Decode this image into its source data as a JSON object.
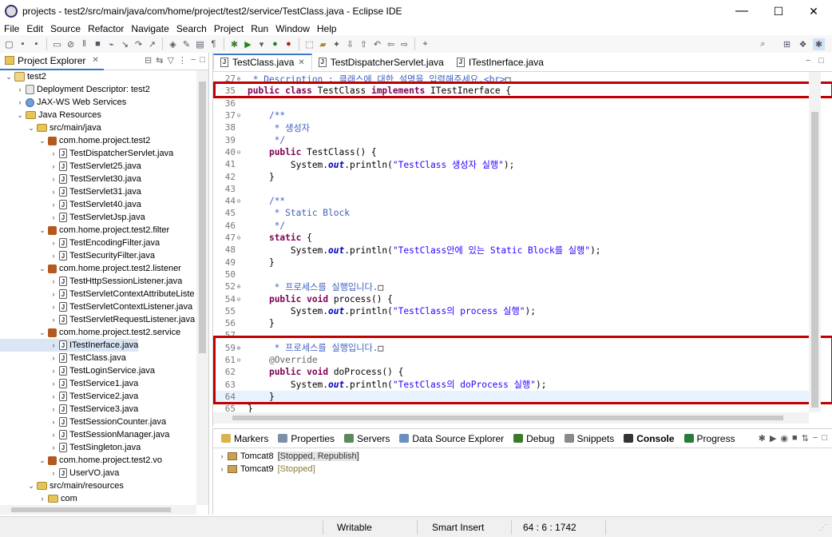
{
  "window": {
    "title": "projects - test2/src/main/java/com/home/project/test2/service/TestClass.java - Eclipse IDE",
    "minimize": "—",
    "maximize": "☐",
    "close": "✕"
  },
  "menu": [
    "File",
    "Edit",
    "Source",
    "Refactor",
    "Navigate",
    "Search",
    "Project",
    "Run",
    "Window",
    "Help"
  ],
  "explorer": {
    "tab_label": "Project Explorer",
    "items": [
      {
        "label": "test2",
        "icon": "project-icon",
        "expanded": true,
        "level": 0
      },
      {
        "label": "Deployment Descriptor: test2",
        "icon": "descriptor-icon",
        "expanded": false,
        "level": 1
      },
      {
        "label": "JAX-WS Web Services",
        "icon": "web-services-icon",
        "expanded": false,
        "level": 1
      },
      {
        "label": "Java Resources",
        "icon": "java-resources-icon",
        "expanded": true,
        "level": 1
      },
      {
        "label": "src/main/java",
        "icon": "source-folder-icon",
        "expanded": true,
        "level": 2
      },
      {
        "label": "com.home.project.test2",
        "icon": "package-icon",
        "expanded": true,
        "level": 3
      },
      {
        "label": "TestDispatcherServlet.java",
        "icon": "java-file-icon",
        "expanded": false,
        "level": 4
      },
      {
        "label": "TestServlet25.java",
        "icon": "java-file-icon",
        "expanded": false,
        "level": 4
      },
      {
        "label": "TestServlet30.java",
        "icon": "java-file-icon",
        "expanded": false,
        "level": 4
      },
      {
        "label": "TestServlet31.java",
        "icon": "java-file-icon",
        "expanded": false,
        "level": 4
      },
      {
        "label": "TestServlet40.java",
        "icon": "java-file-icon",
        "expanded": false,
        "level": 4
      },
      {
        "label": "TestServletJsp.java",
        "icon": "java-file-icon",
        "expanded": false,
        "level": 4
      },
      {
        "label": "com.home.project.test2.filter",
        "icon": "package-icon",
        "expanded": true,
        "level": 3
      },
      {
        "label": "TestEncodingFilter.java",
        "icon": "java-file-icon",
        "expanded": false,
        "level": 4
      },
      {
        "label": "TestSecurityFilter.java",
        "icon": "java-file-icon",
        "expanded": false,
        "level": 4
      },
      {
        "label": "com.home.project.test2.listener",
        "icon": "package-icon",
        "expanded": true,
        "level": 3
      },
      {
        "label": "TestHttpSessionListener.java",
        "icon": "java-file-icon",
        "expanded": false,
        "level": 4
      },
      {
        "label": "TestServletContextAttributeListe",
        "icon": "java-file-icon",
        "expanded": false,
        "level": 4
      },
      {
        "label": "TestServletContextListener.java",
        "icon": "java-file-icon",
        "expanded": false,
        "level": 4
      },
      {
        "label": "TestServletRequestListener.java",
        "icon": "java-file-icon",
        "expanded": false,
        "level": 4
      },
      {
        "label": "com.home.project.test2.service",
        "icon": "package-icon",
        "expanded": true,
        "level": 3
      },
      {
        "label": "ITestInerface.java",
        "icon": "java-file-icon",
        "expanded": false,
        "level": 4,
        "selected": true
      },
      {
        "label": "TestClass.java",
        "icon": "java-file-icon",
        "expanded": false,
        "level": 4
      },
      {
        "label": "TestLoginService.java",
        "icon": "java-file-icon",
        "expanded": false,
        "level": 4
      },
      {
        "label": "TestService1.java",
        "icon": "java-file-icon",
        "expanded": false,
        "level": 4
      },
      {
        "label": "TestService2.java",
        "icon": "java-file-icon",
        "expanded": false,
        "level": 4
      },
      {
        "label": "TestService3.java",
        "icon": "java-file-icon",
        "expanded": false,
        "level": 4
      },
      {
        "label": "TestSessionCounter.java",
        "icon": "java-file-icon",
        "expanded": false,
        "level": 4
      },
      {
        "label": "TestSessionManager.java",
        "icon": "java-file-icon",
        "expanded": false,
        "level": 4
      },
      {
        "label": "TestSingleton.java",
        "icon": "java-file-icon",
        "expanded": false,
        "level": 4
      },
      {
        "label": "com.home.project.test2.vo",
        "icon": "package-icon",
        "expanded": true,
        "level": 3
      },
      {
        "label": "UserVO.java",
        "icon": "java-file-icon",
        "expanded": false,
        "level": 4
      },
      {
        "label": "src/main/resources",
        "icon": "source-folder-icon",
        "expanded": true,
        "level": 2
      },
      {
        "label": "com",
        "icon": "folder-icon",
        "expanded": false,
        "level": 3
      }
    ]
  },
  "editor": {
    "tabs": [
      {
        "label": "TestClass.java",
        "active": true
      },
      {
        "label": "TestDispatcherServlet.java",
        "active": false
      },
      {
        "label": "ITestInerface.java",
        "active": false
      }
    ],
    "lines": [
      {
        "n": "27",
        "fold": "⊕",
        "html": "<span class='cm'> * Description : 클래스에 대한 설명을 입력해주세요.&lt;br&gt;</span>□"
      },
      {
        "n": "35",
        "fold": "",
        "html": "<span class='kw'>public</span> <span class='kw'>class</span> TestClass <span class='kw'>implements</span> ITestInerface {"
      },
      {
        "n": "36",
        "fold": "",
        "html": ""
      },
      {
        "n": "37",
        "fold": "⊖",
        "html": "    <span class='cm'>/**</span>"
      },
      {
        "n": "38",
        "fold": "",
        "html": "<span class='cm'>     * 생성자</span>"
      },
      {
        "n": "39",
        "fold": "",
        "html": "<span class='cm'>     */</span>"
      },
      {
        "n": "40",
        "fold": "⊖",
        "html": "    <span class='kw'>public</span> TestClass() {"
      },
      {
        "n": "41",
        "fold": "",
        "html": "        System.<span class='sf'>out</span>.println(<span class='st'>\"TestClass 생성자 실행\"</span>);"
      },
      {
        "n": "42",
        "fold": "",
        "html": "    }"
      },
      {
        "n": "43",
        "fold": "",
        "html": ""
      },
      {
        "n": "44",
        "fold": "⊖",
        "html": "    <span class='cm'>/**</span>"
      },
      {
        "n": "45",
        "fold": "",
        "html": "<span class='cm'>     * Static Block</span>"
      },
      {
        "n": "46",
        "fold": "",
        "html": "<span class='cm'>     */</span>"
      },
      {
        "n": "47",
        "fold": "⊖",
        "html": "    <span class='kw'>static</span> {"
      },
      {
        "n": "48",
        "fold": "",
        "html": "        System.<span class='sf'>out</span>.println(<span class='st'>\"TestClass안에 있는 Static Block를 실행\"</span>);"
      },
      {
        "n": "49",
        "fold": "",
        "html": "    }"
      },
      {
        "n": "50",
        "fold": "",
        "html": ""
      },
      {
        "n": "52",
        "fold": "⊕",
        "html": "<span class='cm'>     * 프로세스를 실행입니다.</span>□"
      },
      {
        "n": "54",
        "fold": "⊖",
        "html": "    <span class='kw'>public</span> <span class='kw'>void</span> process() {"
      },
      {
        "n": "55",
        "fold": "",
        "html": "        System.<span class='sf'>out</span>.println(<span class='st'>\"TestClass의 process 실행\"</span>);"
      },
      {
        "n": "56",
        "fold": "",
        "html": "    }"
      },
      {
        "n": "57",
        "fold": "",
        "html": ""
      },
      {
        "n": "59",
        "fold": "⊕",
        "html": "<span class='cm'>     * 프로세스를 실행입니다.</span>□"
      },
      {
        "n": "61",
        "fold": "⊖",
        "html": "    <span class='an'>@Override</span>"
      },
      {
        "n": "62",
        "fold": "",
        "html": "    <span class='kw'>public</span> <span class='kw'>void</span> doProcess() {"
      },
      {
        "n": "63",
        "fold": "",
        "html": "        System.<span class='sf'>out</span>.println(<span class='st'>\"TestClass의 doProcess 실행\"</span>);"
      },
      {
        "n": "64",
        "fold": "",
        "html": "    }",
        "current": true
      },
      {
        "n": "65",
        "fold": "",
        "html": "}"
      }
    ]
  },
  "bottom_panel": {
    "tabs": [
      {
        "label": "Markers",
        "icon": "markers-icon",
        "active": false
      },
      {
        "label": "Properties",
        "icon": "properties-icon",
        "active": false
      },
      {
        "label": "Servers",
        "icon": "servers-icon",
        "active": false
      },
      {
        "label": "Data Source Explorer",
        "icon": "data-source-icon",
        "active": false
      },
      {
        "label": "Debug",
        "icon": "debug-icon",
        "active": false
      },
      {
        "label": "Snippets",
        "icon": "snippets-icon",
        "active": false
      },
      {
        "label": "Console",
        "icon": "console-icon",
        "active": true
      },
      {
        "label": "Progress",
        "icon": "progress-icon",
        "active": false
      }
    ],
    "servers": [
      {
        "name": "Tomcat8",
        "status": "[Stopped, Republish]"
      },
      {
        "name": "Tomcat9",
        "status": "[Stopped]"
      }
    ]
  },
  "statusbar": {
    "mode": "Writable",
    "insert": "Smart Insert",
    "position": "64 : 6 : 1742"
  },
  "colors": {
    "highlight_box": "#c00000",
    "keyword": "#7f0055",
    "comment": "#3f5fbf",
    "string": "#2a00ff",
    "selection": "#dbe6f5"
  }
}
